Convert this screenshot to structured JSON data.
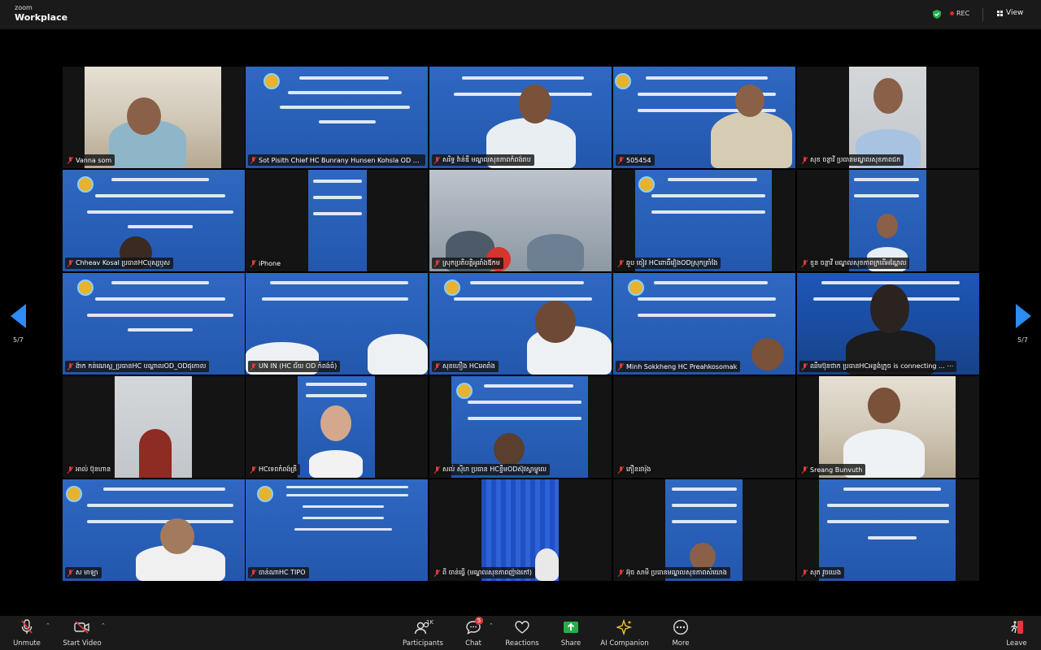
{
  "app": {
    "brand_small": "zoom",
    "brand_name": "Workplace"
  },
  "topbar": {
    "rec_label": "REC",
    "view_label": "View",
    "security_icon": "green-shield-icon"
  },
  "pagination": {
    "left": "5/7",
    "right": "5/7"
  },
  "participants": [
    {
      "name": "Vanna som",
      "muted": true
    },
    {
      "name": "Sot Pisith Chief HC Bunrany Hunsen Kohsla OD C...",
      "muted": true
    },
    {
      "name": "សរិទ្ធ វ៉ាន់ឌី មណ្ឌលសុខភាពកំពង់រាប",
      "muted": true
    },
    {
      "name": "505454",
      "muted": true
    },
    {
      "name": "សុខ ចន្ថាវី ប្រធានមណ្ឌលសុខភាពជក",
      "muted": true
    },
    {
      "name": "Chheav Kosal ប្រធានHCបុស្សឫស",
      "muted": true
    },
    {
      "name": "iPhone",
      "muted": true
    },
    {
      "name": "ស្រុកប្រតិបត្តិអូររាំងឪកម",
      "muted": true
    },
    {
      "name": "ឆួប ចៀវ HCពោធិ៍វៀងODស្រុកត្រាំងែ",
      "muted": true
    },
    {
      "name": "ខួន ចន្ថាវី មណ្ឌលសុខភាពក្រពើអណ្តែល",
      "muted": true
    },
    {
      "name": "ង៉ាក កន់ណេស្ត_ប្រធានHC បណ្តាលOD_ODផុកោល",
      "muted": true
    },
    {
      "name": "UN IN (HC ជ័យ OD កំពង់ធំ)",
      "muted": true
    },
    {
      "name": "សុខហឿង HCអោរាំង",
      "muted": true
    },
    {
      "name": "Minh Sokkheng HC Preahkosomak",
      "muted": true
    },
    {
      "name": "ឈឹមប៊ុនថាក ប្រធានHCអន្លង់ក្រូច is connecting ... ⋯",
      "muted": true
    },
    {
      "name": "អាល់ ប៊ុនហាន",
      "muted": true
    },
    {
      "name": "HCទេពកំពង់ត្រី",
      "muted": true
    },
    {
      "name": "សល់ ស៊ីហ ប្រធាន HCខ្ទឹមODស៊ុវស្វាម្ហូលេ",
      "muted": true
    },
    {
      "name": "ភឿនដារ៉ុង",
      "muted": true
    },
    {
      "name": "Sreang Bunvuth",
      "muted": true
    },
    {
      "name": "ស មាឡា",
      "muted": true
    },
    {
      "name": "ចាន់ណាHC TIPO",
      "muted": true
    },
    {
      "name": "ពី ចាន់ធ្វើ (មណ្ឌលសុខភាពញ៉ាងកៅ)",
      "muted": true
    },
    {
      "name": "អ៊ុច សាមី ប្រធានមណ្ឌលសុខភាពសំយោង",
      "muted": true
    },
    {
      "name": "សុភ វូចឃេង",
      "muted": true
    }
  ],
  "toolbar": {
    "unmute": "Unmute",
    "start_video": "Start Video",
    "participants": "Participants",
    "participants_count": "1K",
    "chat": "Chat",
    "chat_badge": "5",
    "reactions": "Reactions",
    "share": "Share",
    "ai_companion": "AI Companion",
    "more": "More",
    "leave": "Leave"
  },
  "colors": {
    "accent": "#2c8cf4",
    "share_green": "#22b04b",
    "alert_red": "#e0393c",
    "slide_blue": "#2f68c2",
    "ai_gold": "#f2c230"
  }
}
